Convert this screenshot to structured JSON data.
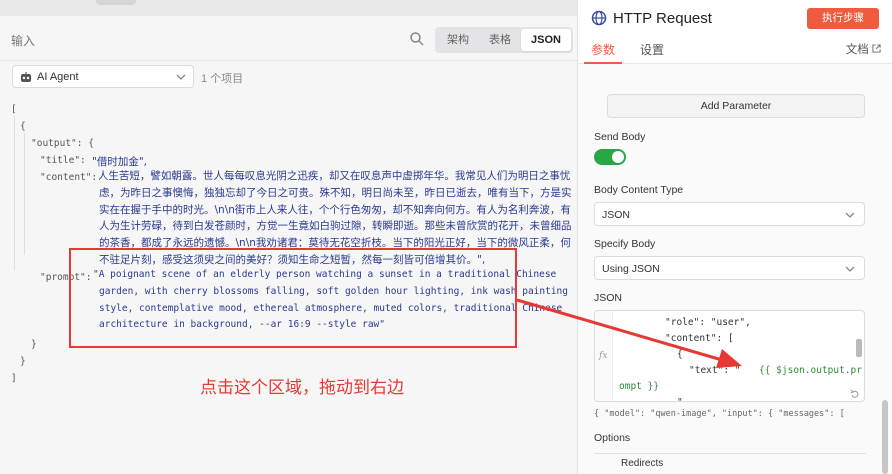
{
  "left": {
    "title": "输入",
    "view_tabs": [
      {
        "label": "架构",
        "active": false
      },
      {
        "label": "表格",
        "active": false
      },
      {
        "label": "JSON",
        "active": true
      }
    ],
    "node_selector": {
      "value": "AI Agent",
      "icon": "robot-icon"
    },
    "item_count": "1 个项目",
    "json": {
      "open_bracket": "[",
      "open_brace": "{",
      "output_key": "\"output\": {",
      "title_key": "\"title\":",
      "title_value": "\"借时加金\",",
      "content_key": "\"content\":",
      "content_value": "\"人生苦短，譬如朝露。世人每每叹息光阴之迅疾，却又在叹息声中虚掷年华。我常见人们为明日之事忧虑，为昨日之事懊悔，独独忘却了今日之可贵。殊不知，明日尚未至，昨日已逝去，唯有当下，方是实实在在握于手中的时光。\\n\\n街市上人来人往，个个行色匆匆，却不知奔向何方。有人为名利奔波，有人为生计劳碌，待到白发苍颜时，方觉一生竟如白驹过隙，转瞬即逝。那些未曾欣赏的花开，未曾细品的茶香，都成了永远的遗憾。\\n\\n我劝诸君：莫待无花空折枝。当下的阳光正好，当下的微风正柔，何不驻足片刻，感受这须臾之间的美好？须知生命之短暂，然每一刻皆可倍增其价。\",",
      "prompt_key": "\"prompt\":",
      "prompt_value": "\"A poignant scene of an elderly person watching a sunset in a traditional Chinese garden, with cherry blossoms falling, soft golden hour lighting, ink wash painting style, contemplative mood, ethereal atmosphere, muted colors, traditional Chinese architecture in background, --ar 16:9 --style raw\"",
      "close_inner": "}",
      "close_brace": "}",
      "close_bracket": "]"
    },
    "annotation_hint": "点击这个区域，拖动到右边"
  },
  "right": {
    "title": "HTTP Request",
    "execute_button": "执行步骤",
    "tabs": [
      {
        "label": "参数",
        "active": true
      },
      {
        "label": "设置",
        "active": false
      }
    ],
    "docs_link": "文档",
    "add_parameter": "Add Parameter",
    "send_body_label": "Send Body",
    "send_body_enabled": true,
    "body_content_type_label": "Body Content Type",
    "body_content_type_value": "JSON",
    "specify_body_label": "Specify Body",
    "specify_body_value": "Using JSON",
    "json_label": "JSON",
    "editor_lines": [
      "\"role\": \"user\",",
      "\"content\": [",
      "{",
      "\"text\": \"",
      "{{ $json.output.pr",
      "ompt }}",
      "\""
    ],
    "preview": "{  \"model\": \"qwen-image\",  \"input\": {    \"messages\": [",
    "options_label": "Options",
    "redirects_label": "Redirects"
  },
  "colors": {
    "accent": "#ef5b3f",
    "annotation": "#e53935",
    "toggle_on": "#28a745",
    "expression": "#2e8b3a"
  }
}
